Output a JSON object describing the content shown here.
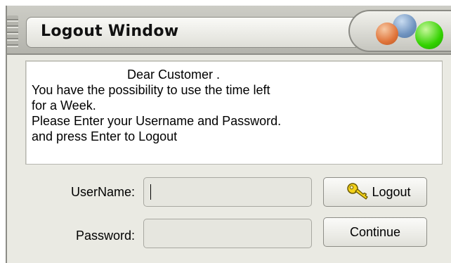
{
  "window": {
    "title": "Logout Window"
  },
  "message": {
    "lines": [
      "Dear Customer .",
      "You have the possibility to use the time left",
      "for a Week.",
      "Please Enter your Username and Password.",
      "and press Enter to Logout"
    ]
  },
  "form": {
    "username_label": "UserName:",
    "username_value": "",
    "password_label": "Password:",
    "password_value": ""
  },
  "buttons": {
    "logout_label": "Logout",
    "logout_icon": "key-icon",
    "continue_label": "Continue"
  },
  "colors": {
    "window_bg": "#eaeae3",
    "light_orange": "#e0743a",
    "light_blue": "#6f93bf",
    "light_green": "#33d200"
  }
}
